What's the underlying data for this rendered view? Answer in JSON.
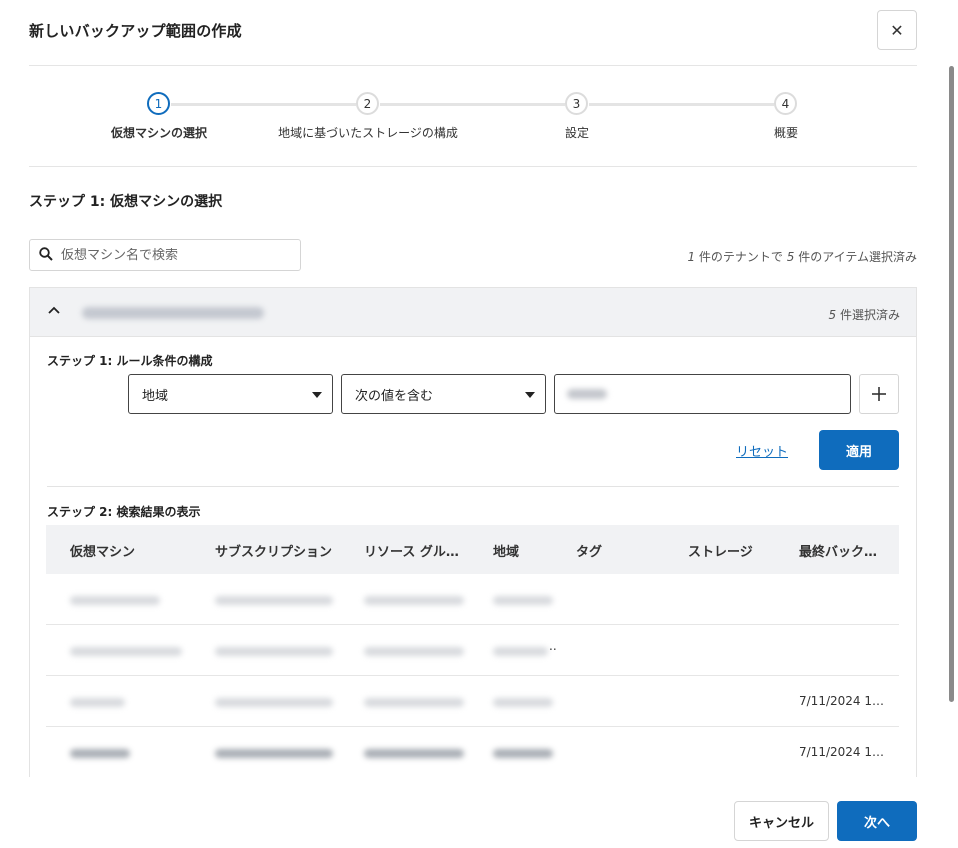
{
  "dialog": {
    "title": "新しいバックアップ範囲の作成",
    "close_label": "✕"
  },
  "stepper": {
    "steps": [
      {
        "number": "1",
        "label": "仮想マシンの選択",
        "state": "active"
      },
      {
        "number": "2",
        "label": "地域に基づいたストレージの構成",
        "state": "pending"
      },
      {
        "number": "3",
        "label": "設定",
        "state": "pending"
      },
      {
        "number": "4",
        "label": "概要",
        "state": "pending"
      }
    ]
  },
  "section_title": "ステップ 1: 仮想マシンの選択",
  "search": {
    "placeholder": "仮想マシン名で検索",
    "value": ""
  },
  "summary": {
    "tenant_count": "1",
    "tenant_text": " 件のテナントで ",
    "item_count": "5",
    "item_text": " 件のアイテム選択済み"
  },
  "panel": {
    "expanded": true,
    "selected_count": "5",
    "selected_text": " 件選択済み",
    "rule_step_title": "ステップ 1: ルール条件の構成",
    "rule": {
      "field": "地域",
      "operator": "次の値を含む"
    },
    "reset_label": "リセット",
    "apply_label": "適用",
    "results_step_title": "ステップ 2: 検索結果の表示",
    "columns": [
      "仮想マシン",
      "サブスクリプション",
      "リソース グル…",
      "地域",
      "タグ",
      "ストレージ",
      "最終バック…"
    ],
    "rows": [
      {
        "last_backup": "",
        "note": ""
      },
      {
        "last_backup": "",
        "note": ".."
      },
      {
        "last_backup": "7/11/2024 1…",
        "note": ""
      },
      {
        "last_backup": "7/11/2024 1…",
        "note": ""
      }
    ]
  },
  "footer": {
    "cancel_label": "キャンセル",
    "next_label": "次へ"
  },
  "colors": {
    "accent": "#0f6cbd",
    "header_bg": "#f1f2f4"
  }
}
